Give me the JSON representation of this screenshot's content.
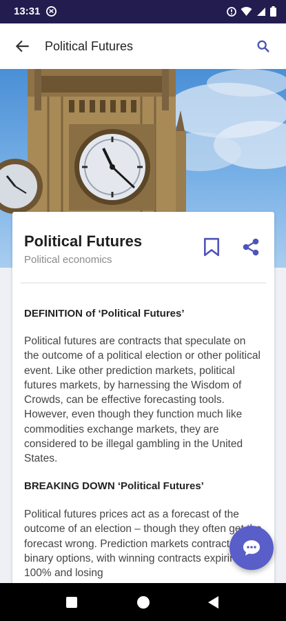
{
  "status_bar": {
    "time": "13:31"
  },
  "app_bar": {
    "title": "Political Futures",
    "back_icon": "arrow-left-icon",
    "search_icon": "search-icon"
  },
  "article": {
    "title": "Political Futures",
    "category": "Political economics",
    "definition_heading": "DEFINITION of ‘Political Futures’",
    "definition_body": "Political futures are contracts that speculate on the outcome of a political election or other political event. Like other prediction markets, political futures markets, by harnessing the Wisdom of Crowds, can be effective forecasting tools. However, even though they function much like commodities exchange markets, they are considered to be illegal gambling in the United States.",
    "breakdown_heading": "BREAKING DOWN ‘Political Futures’",
    "breakdown_body": "Political futures prices act as a forecast of the outcome of an election – though they often get the forecast wrong. Prediction markets contracts are binary options, with winning contracts expiring at 100% and losing"
  },
  "colors": {
    "accent": "#4f54b8",
    "status_bar": "#231c4f",
    "fab": "#5a5ec8"
  }
}
